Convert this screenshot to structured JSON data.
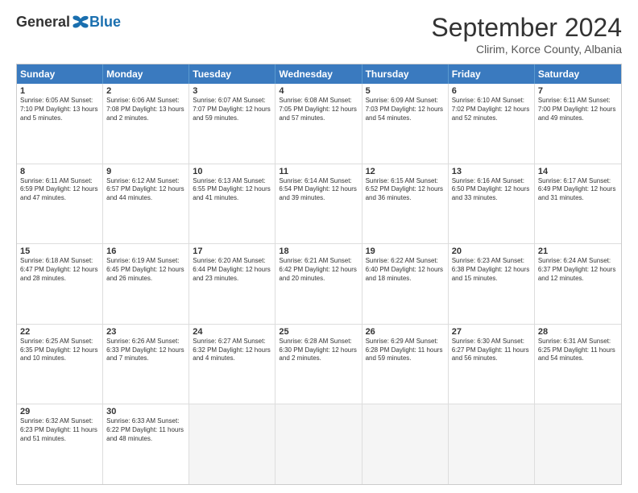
{
  "logo": {
    "general": "General",
    "blue": "Blue"
  },
  "title": "September 2024",
  "subtitle": "Clirim, Korce County, Albania",
  "days": [
    "Sunday",
    "Monday",
    "Tuesday",
    "Wednesday",
    "Thursday",
    "Friday",
    "Saturday"
  ],
  "weeks": [
    [
      {
        "day": 1,
        "info": "Sunrise: 6:05 AM\nSunset: 7:10 PM\nDaylight: 13 hours\nand 5 minutes."
      },
      {
        "day": 2,
        "info": "Sunrise: 6:06 AM\nSunset: 7:08 PM\nDaylight: 13 hours\nand 2 minutes."
      },
      {
        "day": 3,
        "info": "Sunrise: 6:07 AM\nSunset: 7:07 PM\nDaylight: 12 hours\nand 59 minutes."
      },
      {
        "day": 4,
        "info": "Sunrise: 6:08 AM\nSunset: 7:05 PM\nDaylight: 12 hours\nand 57 minutes."
      },
      {
        "day": 5,
        "info": "Sunrise: 6:09 AM\nSunset: 7:03 PM\nDaylight: 12 hours\nand 54 minutes."
      },
      {
        "day": 6,
        "info": "Sunrise: 6:10 AM\nSunset: 7:02 PM\nDaylight: 12 hours\nand 52 minutes."
      },
      {
        "day": 7,
        "info": "Sunrise: 6:11 AM\nSunset: 7:00 PM\nDaylight: 12 hours\nand 49 minutes."
      }
    ],
    [
      {
        "day": 8,
        "info": "Sunrise: 6:11 AM\nSunset: 6:59 PM\nDaylight: 12 hours\nand 47 minutes."
      },
      {
        "day": 9,
        "info": "Sunrise: 6:12 AM\nSunset: 6:57 PM\nDaylight: 12 hours\nand 44 minutes."
      },
      {
        "day": 10,
        "info": "Sunrise: 6:13 AM\nSunset: 6:55 PM\nDaylight: 12 hours\nand 41 minutes."
      },
      {
        "day": 11,
        "info": "Sunrise: 6:14 AM\nSunset: 6:54 PM\nDaylight: 12 hours\nand 39 minutes."
      },
      {
        "day": 12,
        "info": "Sunrise: 6:15 AM\nSunset: 6:52 PM\nDaylight: 12 hours\nand 36 minutes."
      },
      {
        "day": 13,
        "info": "Sunrise: 6:16 AM\nSunset: 6:50 PM\nDaylight: 12 hours\nand 33 minutes."
      },
      {
        "day": 14,
        "info": "Sunrise: 6:17 AM\nSunset: 6:49 PM\nDaylight: 12 hours\nand 31 minutes."
      }
    ],
    [
      {
        "day": 15,
        "info": "Sunrise: 6:18 AM\nSunset: 6:47 PM\nDaylight: 12 hours\nand 28 minutes."
      },
      {
        "day": 16,
        "info": "Sunrise: 6:19 AM\nSunset: 6:45 PM\nDaylight: 12 hours\nand 26 minutes."
      },
      {
        "day": 17,
        "info": "Sunrise: 6:20 AM\nSunset: 6:44 PM\nDaylight: 12 hours\nand 23 minutes."
      },
      {
        "day": 18,
        "info": "Sunrise: 6:21 AM\nSunset: 6:42 PM\nDaylight: 12 hours\nand 20 minutes."
      },
      {
        "day": 19,
        "info": "Sunrise: 6:22 AM\nSunset: 6:40 PM\nDaylight: 12 hours\nand 18 minutes."
      },
      {
        "day": 20,
        "info": "Sunrise: 6:23 AM\nSunset: 6:38 PM\nDaylight: 12 hours\nand 15 minutes."
      },
      {
        "day": 21,
        "info": "Sunrise: 6:24 AM\nSunset: 6:37 PM\nDaylight: 12 hours\nand 12 minutes."
      }
    ],
    [
      {
        "day": 22,
        "info": "Sunrise: 6:25 AM\nSunset: 6:35 PM\nDaylight: 12 hours\nand 10 minutes."
      },
      {
        "day": 23,
        "info": "Sunrise: 6:26 AM\nSunset: 6:33 PM\nDaylight: 12 hours\nand 7 minutes."
      },
      {
        "day": 24,
        "info": "Sunrise: 6:27 AM\nSunset: 6:32 PM\nDaylight: 12 hours\nand 4 minutes."
      },
      {
        "day": 25,
        "info": "Sunrise: 6:28 AM\nSunset: 6:30 PM\nDaylight: 12 hours\nand 2 minutes."
      },
      {
        "day": 26,
        "info": "Sunrise: 6:29 AM\nSunset: 6:28 PM\nDaylight: 11 hours\nand 59 minutes."
      },
      {
        "day": 27,
        "info": "Sunrise: 6:30 AM\nSunset: 6:27 PM\nDaylight: 11 hours\nand 56 minutes."
      },
      {
        "day": 28,
        "info": "Sunrise: 6:31 AM\nSunset: 6:25 PM\nDaylight: 11 hours\nand 54 minutes."
      }
    ],
    [
      {
        "day": 29,
        "info": "Sunrise: 6:32 AM\nSunset: 6:23 PM\nDaylight: 11 hours\nand 51 minutes."
      },
      {
        "day": 30,
        "info": "Sunrise: 6:33 AM\nSunset: 6:22 PM\nDaylight: 11 hours\nand 48 minutes."
      },
      {
        "day": null
      },
      {
        "day": null
      },
      {
        "day": null
      },
      {
        "day": null
      },
      {
        "day": null
      }
    ]
  ]
}
